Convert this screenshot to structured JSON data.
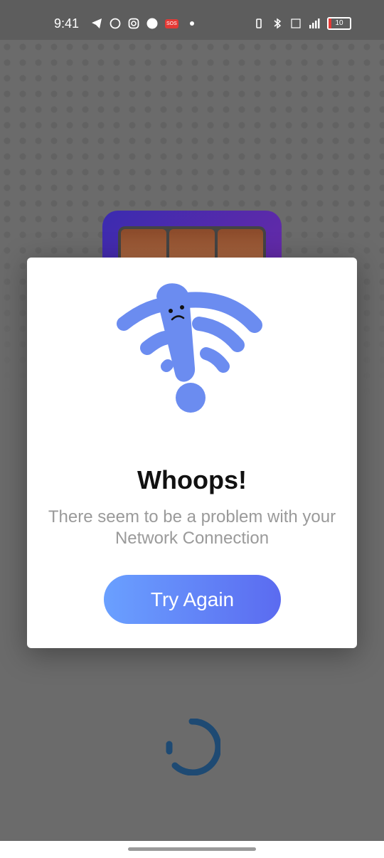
{
  "status_bar": {
    "time": "9:41",
    "left_icons": [
      "telegram-icon",
      "whatsapp-icon",
      "instagram-icon",
      "phone-icon",
      "sos-icon",
      "notification-dot"
    ],
    "sos_label": "SOS",
    "right_icons": [
      "vibrate-icon",
      "bluetooth-icon",
      "volte-icon",
      "signal-icon",
      "battery-icon"
    ],
    "battery_level": "10",
    "battery_color": "#e53935"
  },
  "dialog": {
    "title": "Whoops!",
    "message": "There seem to be a problem with your Network Connection",
    "button_label": "Try Again",
    "illustration": "no-wifi-exclamation",
    "accent_color": "#6b8cf0"
  },
  "loader": {
    "icon": "loading-spinner",
    "color": "#1e4a73"
  }
}
